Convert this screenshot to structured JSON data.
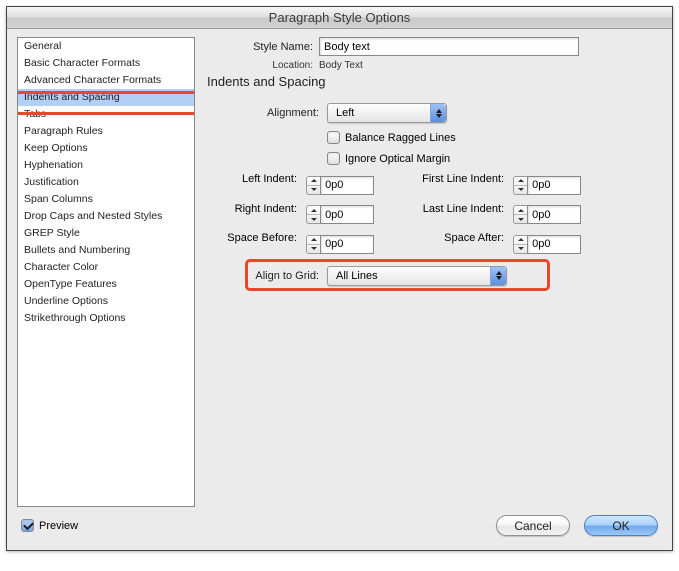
{
  "window": {
    "title": "Paragraph Style Options"
  },
  "sidebar": {
    "items": [
      {
        "label": "General"
      },
      {
        "label": "Basic Character Formats"
      },
      {
        "label": "Advanced Character Formats"
      },
      {
        "label": "Indents and Spacing"
      },
      {
        "label": "Tabs"
      },
      {
        "label": "Paragraph Rules"
      },
      {
        "label": "Keep Options"
      },
      {
        "label": "Hyphenation"
      },
      {
        "label": "Justification"
      },
      {
        "label": "Span Columns"
      },
      {
        "label": "Drop Caps and Nested Styles"
      },
      {
        "label": "GREP Style"
      },
      {
        "label": "Bullets and Numbering"
      },
      {
        "label": "Character Color"
      },
      {
        "label": "OpenType Features"
      },
      {
        "label": "Underline Options"
      },
      {
        "label": "Strikethrough Options"
      }
    ],
    "selected_index": 3
  },
  "main": {
    "style_name_label": "Style Name:",
    "style_name_value": "Body text",
    "location_label": "Location:",
    "location_value": "Body Text",
    "section_title": "Indents and Spacing",
    "alignment_label": "Alignment:",
    "alignment_value": "Left",
    "balance_label": "Balance Ragged Lines",
    "ignore_label": "Ignore Optical Margin",
    "left_indent_label": "Left Indent:",
    "left_indent_value": "0p0",
    "first_line_label": "First Line Indent:",
    "first_line_value": "0p0",
    "right_indent_label": "Right Indent:",
    "right_indent_value": "0p0",
    "last_line_label": "Last Line Indent:",
    "last_line_value": "0p0",
    "space_before_label": "Space Before:",
    "space_before_value": "0p0",
    "space_after_label": "Space After:",
    "space_after_value": "0p0",
    "align_grid_label": "Align to Grid:",
    "align_grid_value": "All Lines"
  },
  "footer": {
    "preview_label": "Preview",
    "cancel_label": "Cancel",
    "ok_label": "OK"
  }
}
